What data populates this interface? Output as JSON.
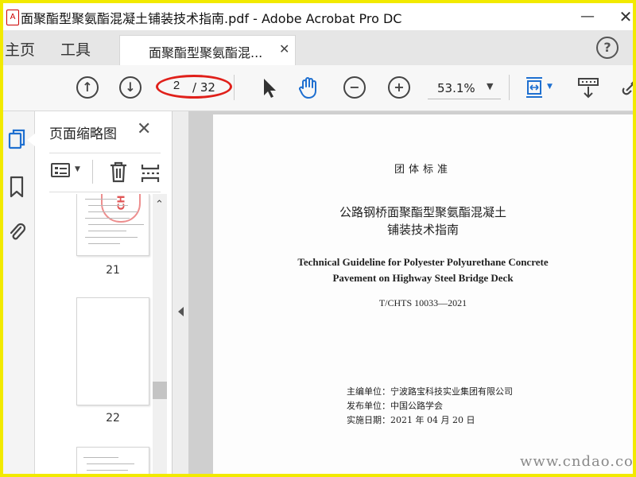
{
  "window": {
    "title": "面聚酯型聚氨酯混凝土铺装技术指南.pdf - Adobe Acrobat Pro DC",
    "minimize_glyph": "—",
    "close_glyph": "✕"
  },
  "tabs": {
    "home": "主页",
    "tools": "工具",
    "document": "面聚酯型聚氨酯混...",
    "close_glyph": "✕",
    "help_glyph": "?"
  },
  "toolbar": {
    "current_page": "2",
    "total_pages": "/ 32",
    "zoom": "53.1%",
    "prev_page_glyph": "↑",
    "next_page_glyph": "↓",
    "zoom_out_glyph": "−",
    "zoom_in_glyph": "+",
    "caret_glyph": "▼",
    "highlight_color": "#e0201a",
    "accent_color": "#1e6fd0"
  },
  "sidebar": {
    "panel_title": "页面缩略图",
    "close_glyph": "✕",
    "thumbnails": [
      {
        "label": "21",
        "stamp": "CH"
      },
      {
        "label": "22"
      }
    ]
  },
  "document": {
    "category": "团体标准",
    "title_cn_line1": "公路钢桥面聚酯型聚氨酯混凝土",
    "title_cn_line2": "铺装技术指南",
    "title_en_line1": "Technical Guideline for Polyester Polyurethane Concrete",
    "title_en_line2": "Pavement on Highway Steel Bridge Deck",
    "standard_code": "T/CHTS  10033—2021",
    "editor_unit": "主编单位：宁波路宝科技实业集团有限公司",
    "publisher_unit": "发布单位：中国公路学会",
    "effective_date": "实施日期：2021 年 04 月 20 日"
  },
  "watermark": "www.cndao.com"
}
